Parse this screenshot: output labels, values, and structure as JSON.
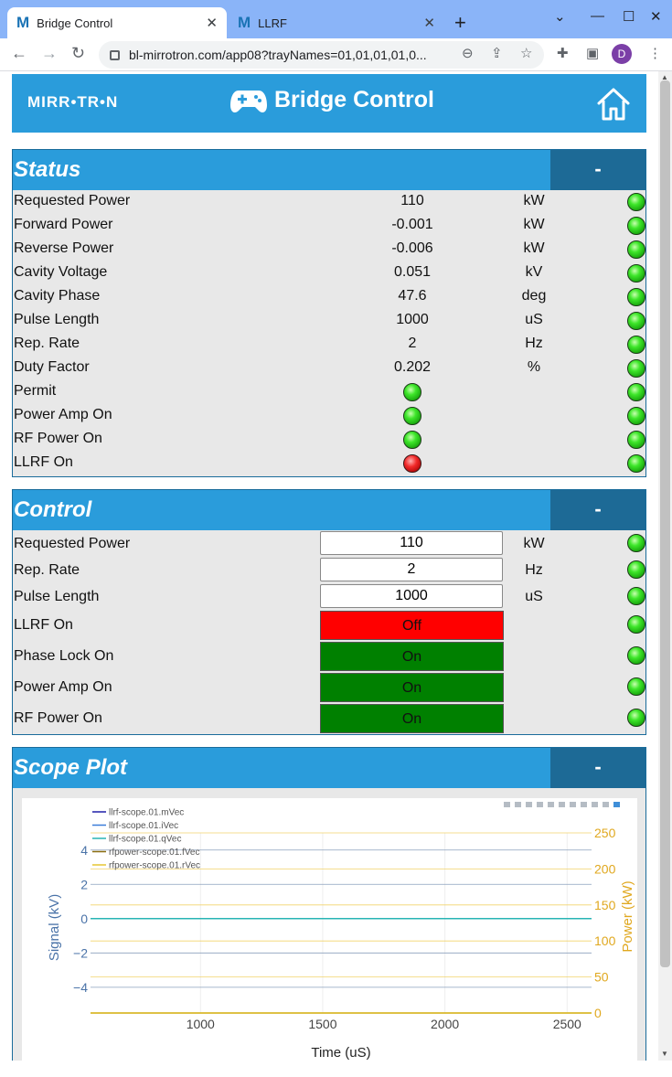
{
  "browser": {
    "tabs": [
      {
        "icon": "M",
        "title": "Bridge Control",
        "active": true
      },
      {
        "icon": "M",
        "title": "LLRF",
        "active": false
      }
    ],
    "url": "bl-mirrotron.com/app08?trayNames=01,01,01,01,0...",
    "profile_initial": "D"
  },
  "header": {
    "logo": "MIRR•TR•N",
    "title": "Bridge Control"
  },
  "status": {
    "title": "Status",
    "collapse": "-",
    "rows": [
      {
        "label": "Requested Power",
        "value": "110",
        "unit": "kW",
        "led": "green"
      },
      {
        "label": "Forward Power",
        "value": "-0.001",
        "unit": "kW",
        "led": "green"
      },
      {
        "label": "Reverse Power",
        "value": "-0.006",
        "unit": "kW",
        "led": "green"
      },
      {
        "label": "Cavity Voltage",
        "value": "0.051",
        "unit": "kV",
        "led": "green"
      },
      {
        "label": "Cavity Phase",
        "value": "47.6",
        "unit": "deg",
        "led": "green"
      },
      {
        "label": "Pulse Length",
        "value": "1000",
        "unit": "uS",
        "led": "green"
      },
      {
        "label": "Rep. Rate",
        "value": "2",
        "unit": "Hz",
        "led": "green"
      },
      {
        "label": "Duty Factor",
        "value": "0.202",
        "unit": "%",
        "led": "green"
      },
      {
        "label": "Permit",
        "mid_led": "green",
        "led": "green"
      },
      {
        "label": "Power Amp On",
        "mid_led": "green",
        "led": "green"
      },
      {
        "label": "RF Power On",
        "mid_led": "green",
        "led": "green"
      },
      {
        "label": "LLRF On",
        "mid_led": "red",
        "led": "green"
      }
    ]
  },
  "control": {
    "title": "Control",
    "collapse": "-",
    "inputs": [
      {
        "label": "Requested Power",
        "value": "110",
        "unit": "kW",
        "led": "green"
      },
      {
        "label": "Rep. Rate",
        "value": "2",
        "unit": "Hz",
        "led": "green"
      },
      {
        "label": "Pulse Length",
        "value": "1000",
        "unit": "uS",
        "led": "green"
      }
    ],
    "toggles": [
      {
        "label": "LLRF On",
        "state": "Off",
        "led": "green"
      },
      {
        "label": "Phase Lock On",
        "state": "On",
        "led": "green"
      },
      {
        "label": "Power Amp On",
        "state": "On",
        "led": "green"
      },
      {
        "label": "RF Power On",
        "state": "On",
        "led": "green"
      }
    ]
  },
  "scope": {
    "title": "Scope Plot",
    "collapse": "-"
  },
  "chart_data": {
    "type": "line",
    "xlabel": "Time (uS)",
    "ylabel": "Signal (kV)",
    "y2label": "Power (kW)",
    "xlim": [
      550,
      2600
    ],
    "ylim": [
      -5.5,
      5
    ],
    "y2lim": [
      0,
      250
    ],
    "xticks": [
      1000,
      1500,
      2000,
      2500
    ],
    "yticks": [
      4,
      2,
      0,
      -2,
      -4
    ],
    "y2ticks": [
      250,
      200,
      150,
      100,
      50,
      0
    ],
    "left_axis_color": "#4a73a8",
    "right_axis_color": "#e0a81f",
    "series": [
      {
        "name": "llrf-scope.01.mVec",
        "color": "#1f1fa8",
        "x": [
          550,
          2600
        ],
        "y": [
          0,
          0
        ]
      },
      {
        "name": "llrf-scope.01.iVec",
        "color": "#3b7dd8",
        "x": [
          550,
          2600
        ],
        "y": [
          0,
          0
        ]
      },
      {
        "name": "llrf-scope.01.qVec",
        "color": "#28b4b4",
        "x": [
          550,
          2600
        ],
        "y": [
          0,
          0
        ]
      },
      {
        "name": "rfpower-scope.01.fVec",
        "color": "#8a6d10",
        "x": [
          550,
          2600
        ],
        "y": [
          0,
          0
        ]
      },
      {
        "name": "rfpower-scope.01.rVec",
        "color": "#e6c531",
        "x": [
          550,
          2600
        ],
        "y": [
          0,
          0
        ]
      }
    ],
    "legend": "top-left",
    "grid": true
  },
  "colors": {
    "header_bg": "#2a9cdb",
    "collapse_bg": "#1d6a96",
    "off_button": "#ff0000",
    "on_button": "#008000"
  }
}
